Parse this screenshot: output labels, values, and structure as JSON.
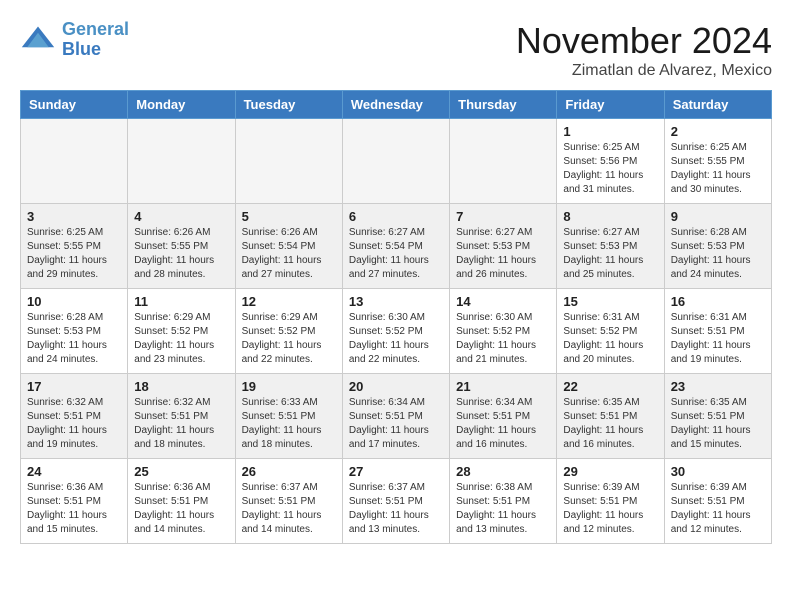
{
  "logo": {
    "line1": "General",
    "line2": "Blue"
  },
  "title": "November 2024",
  "location": "Zimatlan de Alvarez, Mexico",
  "headers": [
    "Sunday",
    "Monday",
    "Tuesday",
    "Wednesday",
    "Thursday",
    "Friday",
    "Saturday"
  ],
  "weeks": [
    [
      {
        "day": "",
        "info": ""
      },
      {
        "day": "",
        "info": ""
      },
      {
        "day": "",
        "info": ""
      },
      {
        "day": "",
        "info": ""
      },
      {
        "day": "",
        "info": ""
      },
      {
        "day": "1",
        "info": "Sunrise: 6:25 AM\nSunset: 5:56 PM\nDaylight: 11 hours\nand 31 minutes."
      },
      {
        "day": "2",
        "info": "Sunrise: 6:25 AM\nSunset: 5:55 PM\nDaylight: 11 hours\nand 30 minutes."
      }
    ],
    [
      {
        "day": "3",
        "info": "Sunrise: 6:25 AM\nSunset: 5:55 PM\nDaylight: 11 hours\nand 29 minutes."
      },
      {
        "day": "4",
        "info": "Sunrise: 6:26 AM\nSunset: 5:55 PM\nDaylight: 11 hours\nand 28 minutes."
      },
      {
        "day": "5",
        "info": "Sunrise: 6:26 AM\nSunset: 5:54 PM\nDaylight: 11 hours\nand 27 minutes."
      },
      {
        "day": "6",
        "info": "Sunrise: 6:27 AM\nSunset: 5:54 PM\nDaylight: 11 hours\nand 27 minutes."
      },
      {
        "day": "7",
        "info": "Sunrise: 6:27 AM\nSunset: 5:53 PM\nDaylight: 11 hours\nand 26 minutes."
      },
      {
        "day": "8",
        "info": "Sunrise: 6:27 AM\nSunset: 5:53 PM\nDaylight: 11 hours\nand 25 minutes."
      },
      {
        "day": "9",
        "info": "Sunrise: 6:28 AM\nSunset: 5:53 PM\nDaylight: 11 hours\nand 24 minutes."
      }
    ],
    [
      {
        "day": "10",
        "info": "Sunrise: 6:28 AM\nSunset: 5:53 PM\nDaylight: 11 hours\nand 24 minutes."
      },
      {
        "day": "11",
        "info": "Sunrise: 6:29 AM\nSunset: 5:52 PM\nDaylight: 11 hours\nand 23 minutes."
      },
      {
        "day": "12",
        "info": "Sunrise: 6:29 AM\nSunset: 5:52 PM\nDaylight: 11 hours\nand 22 minutes."
      },
      {
        "day": "13",
        "info": "Sunrise: 6:30 AM\nSunset: 5:52 PM\nDaylight: 11 hours\nand 22 minutes."
      },
      {
        "day": "14",
        "info": "Sunrise: 6:30 AM\nSunset: 5:52 PM\nDaylight: 11 hours\nand 21 minutes."
      },
      {
        "day": "15",
        "info": "Sunrise: 6:31 AM\nSunset: 5:52 PM\nDaylight: 11 hours\nand 20 minutes."
      },
      {
        "day": "16",
        "info": "Sunrise: 6:31 AM\nSunset: 5:51 PM\nDaylight: 11 hours\nand 19 minutes."
      }
    ],
    [
      {
        "day": "17",
        "info": "Sunrise: 6:32 AM\nSunset: 5:51 PM\nDaylight: 11 hours\nand 19 minutes."
      },
      {
        "day": "18",
        "info": "Sunrise: 6:32 AM\nSunset: 5:51 PM\nDaylight: 11 hours\nand 18 minutes."
      },
      {
        "day": "19",
        "info": "Sunrise: 6:33 AM\nSunset: 5:51 PM\nDaylight: 11 hours\nand 18 minutes."
      },
      {
        "day": "20",
        "info": "Sunrise: 6:34 AM\nSunset: 5:51 PM\nDaylight: 11 hours\nand 17 minutes."
      },
      {
        "day": "21",
        "info": "Sunrise: 6:34 AM\nSunset: 5:51 PM\nDaylight: 11 hours\nand 16 minutes."
      },
      {
        "day": "22",
        "info": "Sunrise: 6:35 AM\nSunset: 5:51 PM\nDaylight: 11 hours\nand 16 minutes."
      },
      {
        "day": "23",
        "info": "Sunrise: 6:35 AM\nSunset: 5:51 PM\nDaylight: 11 hours\nand 15 minutes."
      }
    ],
    [
      {
        "day": "24",
        "info": "Sunrise: 6:36 AM\nSunset: 5:51 PM\nDaylight: 11 hours\nand 15 minutes."
      },
      {
        "day": "25",
        "info": "Sunrise: 6:36 AM\nSunset: 5:51 PM\nDaylight: 11 hours\nand 14 minutes."
      },
      {
        "day": "26",
        "info": "Sunrise: 6:37 AM\nSunset: 5:51 PM\nDaylight: 11 hours\nand 14 minutes."
      },
      {
        "day": "27",
        "info": "Sunrise: 6:37 AM\nSunset: 5:51 PM\nDaylight: 11 hours\nand 13 minutes."
      },
      {
        "day": "28",
        "info": "Sunrise: 6:38 AM\nSunset: 5:51 PM\nDaylight: 11 hours\nand 13 minutes."
      },
      {
        "day": "29",
        "info": "Sunrise: 6:39 AM\nSunset: 5:51 PM\nDaylight: 11 hours\nand 12 minutes."
      },
      {
        "day": "30",
        "info": "Sunrise: 6:39 AM\nSunset: 5:51 PM\nDaylight: 11 hours\nand 12 minutes."
      }
    ]
  ]
}
